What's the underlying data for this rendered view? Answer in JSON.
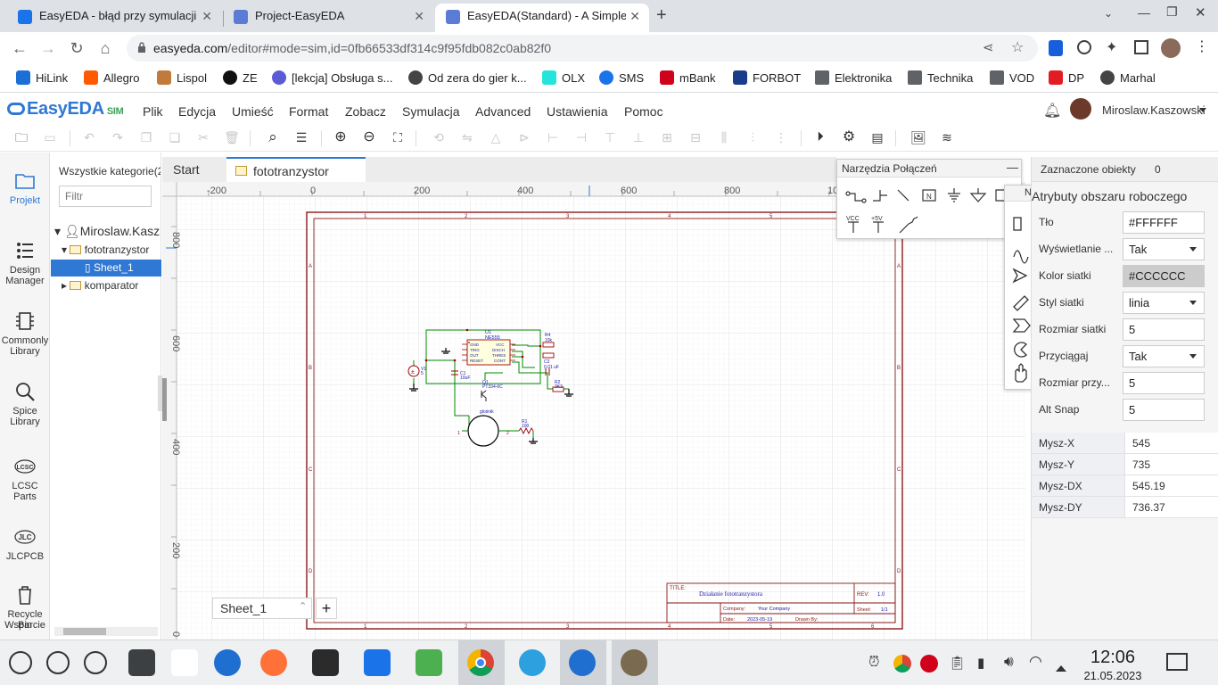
{
  "browser": {
    "tabs": [
      {
        "title": "EasyEDA - błąd przy symulacji",
        "active": false,
        "favicon": "easyeda-forum-icon"
      },
      {
        "title": "Project-EasyEDA",
        "active": false,
        "favicon": "easyeda-cloud-icon"
      },
      {
        "title": "EasyEDA(Standard) - A Simple",
        "active": true,
        "favicon": "easyeda-cloud-icon"
      }
    ],
    "url_host": "easyeda.com",
    "url_path": "/editor#mode=sim,id=0fb66533df314c9f95fdb082c0ab82f0",
    "bookmarks": [
      "HiLink",
      "Allegro",
      "Lispol",
      "ZE",
      "[lekcja] Obsługa s...",
      "Od zera do gier k...",
      "OLX",
      "SMS",
      "mBank",
      "FORBOT",
      "Elektronika",
      "Technika",
      "VOD",
      "DP",
      "Marhal"
    ]
  },
  "app": {
    "logo": "EasyEDA",
    "logo_suffix": "SIM",
    "menu": [
      "Plik",
      "Edycja",
      "Umieść",
      "Format",
      "Zobacz",
      "Symulacja",
      "Advanced",
      "Ustawienia",
      "Pomoc"
    ],
    "user": "Miroslaw.Kaszowski"
  },
  "leftnav": [
    {
      "label": "Projekt",
      "icon": "folder-icon"
    },
    {
      "label": "Design Manager",
      "icon": "design-manager-icon"
    },
    {
      "label": "Commonly Library",
      "icon": "chip-icon"
    },
    {
      "label": "Spice Library",
      "icon": "spice-search-icon"
    },
    {
      "label": "LCSC Parts",
      "icon": "lcsc-icon"
    },
    {
      "label": "JLCPCB",
      "icon": "jlc-icon"
    },
    {
      "label": "Recycle Bin",
      "icon": "trash-icon"
    },
    {
      "label": "Wsparcie",
      "icon": "support-icon"
    }
  ],
  "tree": {
    "header": "Wszystkie kategorie(2",
    "filter_placeholder": "Filtr",
    "owner": "Miroslaw.Kasz",
    "project": "fototranzystor",
    "sheet": "Sheet_1",
    "other": "komparator"
  },
  "editor": {
    "tabs": [
      "Start",
      "fototranzystor"
    ],
    "ruler_top": [
      "-200",
      "0",
      "200",
      "400",
      "600",
      "800",
      "10"
    ],
    "ruler_left": [
      "800",
      "600",
      "400",
      "200",
      "0"
    ],
    "sheet_tab": "Sheet_1",
    "title_block": {
      "title_label": "TITLE:",
      "title": "Działanie fototranzystora",
      "rev_label": "REV:",
      "rev": "1.0",
      "company_label": "Company:",
      "company": "Your Company",
      "sheet_label": "Sheet:",
      "sheet": "1/1",
      "date_label": "Date:",
      "date": "2023-05-19",
      "drawn_label": "Drawn By:"
    },
    "schematic": {
      "u1_ref": "U1",
      "u1_part": "NE555",
      "u1_pins_left": [
        "GND",
        "TRIG",
        "OUT",
        "RESET"
      ],
      "u1_pins_right": [
        "VCC",
        "DISCH",
        "THRES",
        "CONT"
      ],
      "r4": "R4",
      "r4_val": "10k",
      "r4_box": "R4",
      "c2": "C2",
      "c2_val": "0.01 uF",
      "r2": "R2",
      "r2_val": "3K3",
      "c1": "C1",
      "c1_val": "10uF",
      "v1": "V1",
      "v1_val": "5",
      "q1": "Q1",
      "q1_part": "PT334-6C",
      "speaker": "glośnik",
      "r1": "R1",
      "r1_val": "100"
    }
  },
  "conn_tools": {
    "title": "Narzędzia Połączeń",
    "vcc": "VCC",
    "p5v": "+5V"
  },
  "draw_tools_title": "Narz...",
  "right_panel": {
    "selected_label": "Zaznaczone obiekty",
    "selected_count": "0",
    "section_title": "Atrybuty obszaru roboczego",
    "fields": [
      {
        "label": "Tło",
        "value": "#FFFFFF",
        "kind": "input"
      },
      {
        "label": "Wyświetlanie ...",
        "value": "Tak",
        "kind": "select"
      },
      {
        "label": "Kolor siatki",
        "value": "#CCCCCC",
        "kind": "input"
      },
      {
        "label": "Styl siatki",
        "value": "linia",
        "kind": "select"
      },
      {
        "label": "Rozmiar siatki",
        "value": "5",
        "kind": "input"
      },
      {
        "label": "Przyciągaj",
        "value": "Tak",
        "kind": "select"
      },
      {
        "label": "Rozmiar przy...",
        "value": "5",
        "kind": "input"
      },
      {
        "label": "Alt Snap",
        "value": "5",
        "kind": "input"
      }
    ],
    "mouse": [
      {
        "k": "Mysz-X",
        "v": "545"
      },
      {
        "k": "Mysz-Y",
        "v": "735"
      },
      {
        "k": "Mysz-DX",
        "v": "545.19"
      },
      {
        "k": "Mysz-DY",
        "v": "736.37"
      }
    ]
  },
  "taskbar": {
    "time": "12:06",
    "date": "21.05.2023"
  },
  "colors": {
    "accent": "#2f78d3",
    "sheet_border": "#8b1a1a",
    "wire": "#008800",
    "component": "#a00000",
    "grid": "#e6e6e6"
  }
}
